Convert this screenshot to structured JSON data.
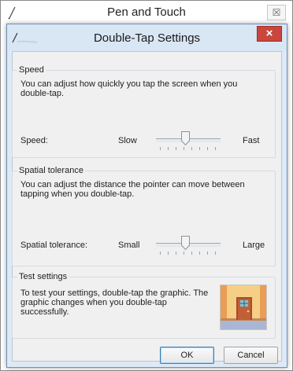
{
  "parent_window": {
    "title": "Pen and Touch",
    "close_glyph": "☒"
  },
  "dialog": {
    "title": "Double-Tap Settings",
    "close_glyph": "×",
    "speed": {
      "legend": "Speed",
      "description": "You can adjust how quickly you tap the screen when you double-tap.",
      "label": "Speed:",
      "min_label": "Slow",
      "max_label": "Fast",
      "value_fraction": 0.45
    },
    "tolerance": {
      "legend": "Spatial tolerance",
      "description": "You can adjust the distance the pointer can move between tapping when you double-tap.",
      "label": "Spatial tolerance:",
      "min_label": "Small",
      "max_label": "Large",
      "value_fraction": 0.45
    },
    "test": {
      "legend": "Test settings",
      "description": "To test your settings, double-tap the graphic. The graphic changes when you double-tap successfully."
    },
    "buttons": {
      "ok": "OK",
      "cancel": "Cancel"
    }
  },
  "colors": {
    "dialog_frame": "#d9e6f4",
    "close_red": "#c9463d",
    "default_button_border": "#3c7fb1"
  },
  "icons": [
    "pen-icon",
    "close-icon",
    "door-icon"
  ]
}
